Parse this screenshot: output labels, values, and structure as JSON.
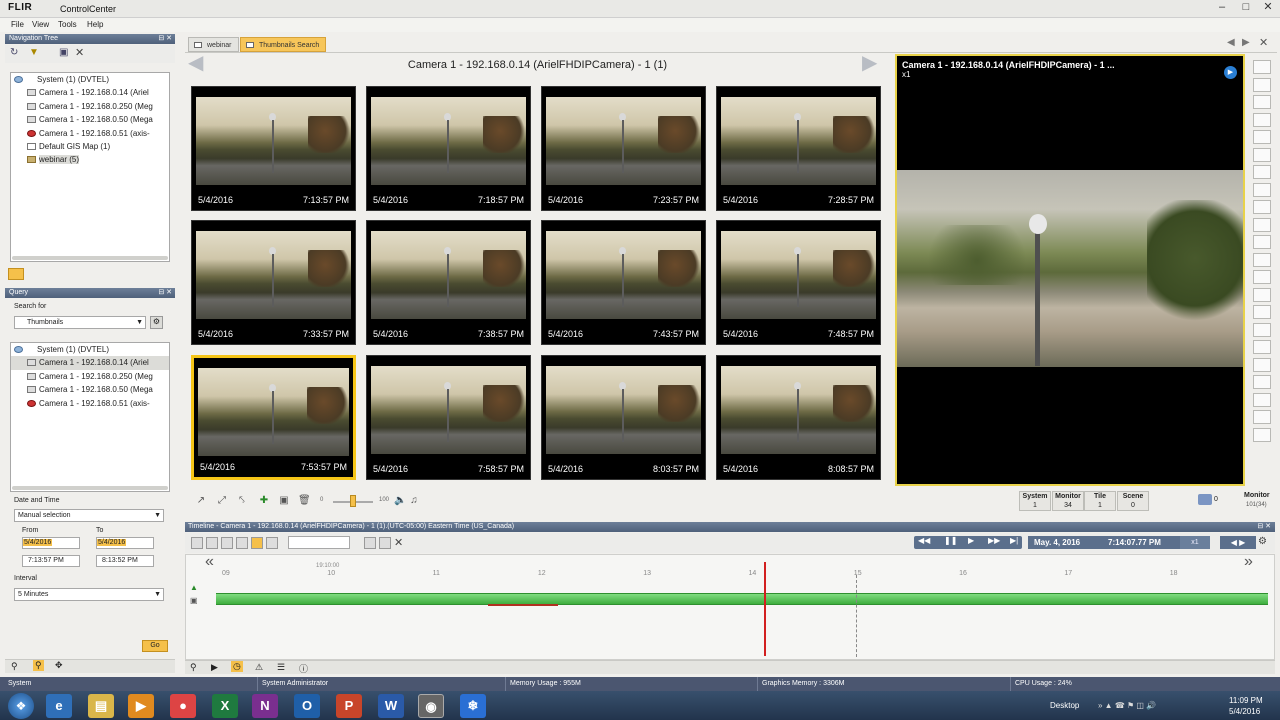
{
  "app": {
    "logo": "FLIR",
    "title": "ControlCenter"
  },
  "menu": [
    "File",
    "View",
    "Tools",
    "Help"
  ],
  "nav_tree": {
    "header": "Navigation Tree",
    "items": [
      {
        "label": "System (1) (DVTEL)",
        "icon": "system-icon"
      },
      {
        "label": "Camera 1 - 192.168.0.14 (Ariel",
        "icon": "camera-icon"
      },
      {
        "label": "Camera 1 - 192.168.0.250 (Meg",
        "icon": "camera-icon"
      },
      {
        "label": "Camera 1 - 192.168.0.50 (Mega",
        "icon": "camera-icon"
      },
      {
        "label": "Camera 1 - 192.168.0.51 (axis-",
        "icon": "camera-red-icon"
      },
      {
        "label": "Default GIS Map (1)",
        "icon": "map-icon"
      },
      {
        "label": "webinar (5)",
        "icon": "layout-icon"
      }
    ]
  },
  "query": {
    "header": "Query",
    "search_for_label": "Search for",
    "search_for_value": "Thumbnails",
    "items": [
      {
        "label": "System (1) (DVTEL)",
        "icon": "system-icon"
      },
      {
        "label": "Camera 1 - 192.168.0.14 (Ariel",
        "icon": "camera-icon"
      },
      {
        "label": "Camera 1 - 192.168.0.250 (Meg",
        "icon": "camera-icon"
      },
      {
        "label": "Camera 1 - 192.168.0.50 (Mega",
        "icon": "camera-icon"
      },
      {
        "label": "Camera 1 - 192.168.0.51 (axis-",
        "icon": "camera-red-icon"
      }
    ],
    "date_time_label": "Date and Time",
    "date_mode": "Manual selection",
    "from_label": "From",
    "to_label": "To",
    "from_date": "5/4/2016",
    "to_date": "5/4/2016",
    "from_time": "7:13:57 PM",
    "to_time": "8:13:52 PM",
    "interval_label": "Interval",
    "interval_value": "5 Minutes",
    "go_label": "Go"
  },
  "tabs": [
    {
      "label": "webinar",
      "active": false
    },
    {
      "label": "Thumbnails Search",
      "active": true
    }
  ],
  "grid_title": "Camera 1 - 192.168.0.14 (ArielFHDIPCamera) - 1 (1)",
  "thumbnails": [
    {
      "date": "5/4/2016",
      "time": "7:13:57 PM"
    },
    {
      "date": "5/4/2016",
      "time": "7:18:57 PM"
    },
    {
      "date": "5/4/2016",
      "time": "7:23:57 PM"
    },
    {
      "date": "5/4/2016",
      "time": "7:28:57 PM"
    },
    {
      "date": "5/4/2016",
      "time": "7:33:57 PM"
    },
    {
      "date": "5/4/2016",
      "time": "7:38:57 PM"
    },
    {
      "date": "5/4/2016",
      "time": "7:43:57 PM"
    },
    {
      "date": "5/4/2016",
      "time": "7:48:57 PM"
    },
    {
      "date": "5/4/2016",
      "time": "7:53:57 PM",
      "selected": true
    },
    {
      "date": "5/4/2016",
      "time": "7:58:57 PM"
    },
    {
      "date": "5/4/2016",
      "time": "8:03:57 PM"
    },
    {
      "date": "5/4/2016",
      "time": "8:08:57 PM"
    }
  ],
  "preview": {
    "title": "Camera 1 - 192.168.0.14 (ArielFHDIPCamera) - 1 ...",
    "subtitle": "x1"
  },
  "toolbar": {
    "volume_min": "0",
    "volume_max": "100"
  },
  "stats": [
    {
      "label": "System",
      "value": "1"
    },
    {
      "label": "Monitor",
      "value": "34"
    },
    {
      "label": "Tile",
      "value": "1"
    },
    {
      "label": "Scene",
      "value": "0"
    }
  ],
  "monitor": {
    "count": "0",
    "label": "Monitor",
    "sub": "101(34)"
  },
  "timeline": {
    "header": "Timeline - Camera 1 - 192.168.0.14 (ArielFHDIPCamera) - 1 (1).(UTC-05:00) Eastern Time (US_Canada)",
    "date": "May. 4, 2016",
    "time": "7:14:07.77 PM",
    "speed": "x1",
    "start_marker": "19:10:00",
    "ticks": [
      "09",
      "10",
      "11",
      "12",
      "13",
      "14",
      "15",
      "16",
      "17",
      "18"
    ]
  },
  "statusbar": {
    "system": "System",
    "user": "System Administrator",
    "memory": "Memory Usage : 955M",
    "graphics": "Graphics Memory : 3306M",
    "cpu": "CPU Usage : 24%"
  },
  "taskbar": {
    "desktop_label": "Desktop",
    "clock_time": "11:09 PM",
    "clock_date": "5/4/2016"
  }
}
